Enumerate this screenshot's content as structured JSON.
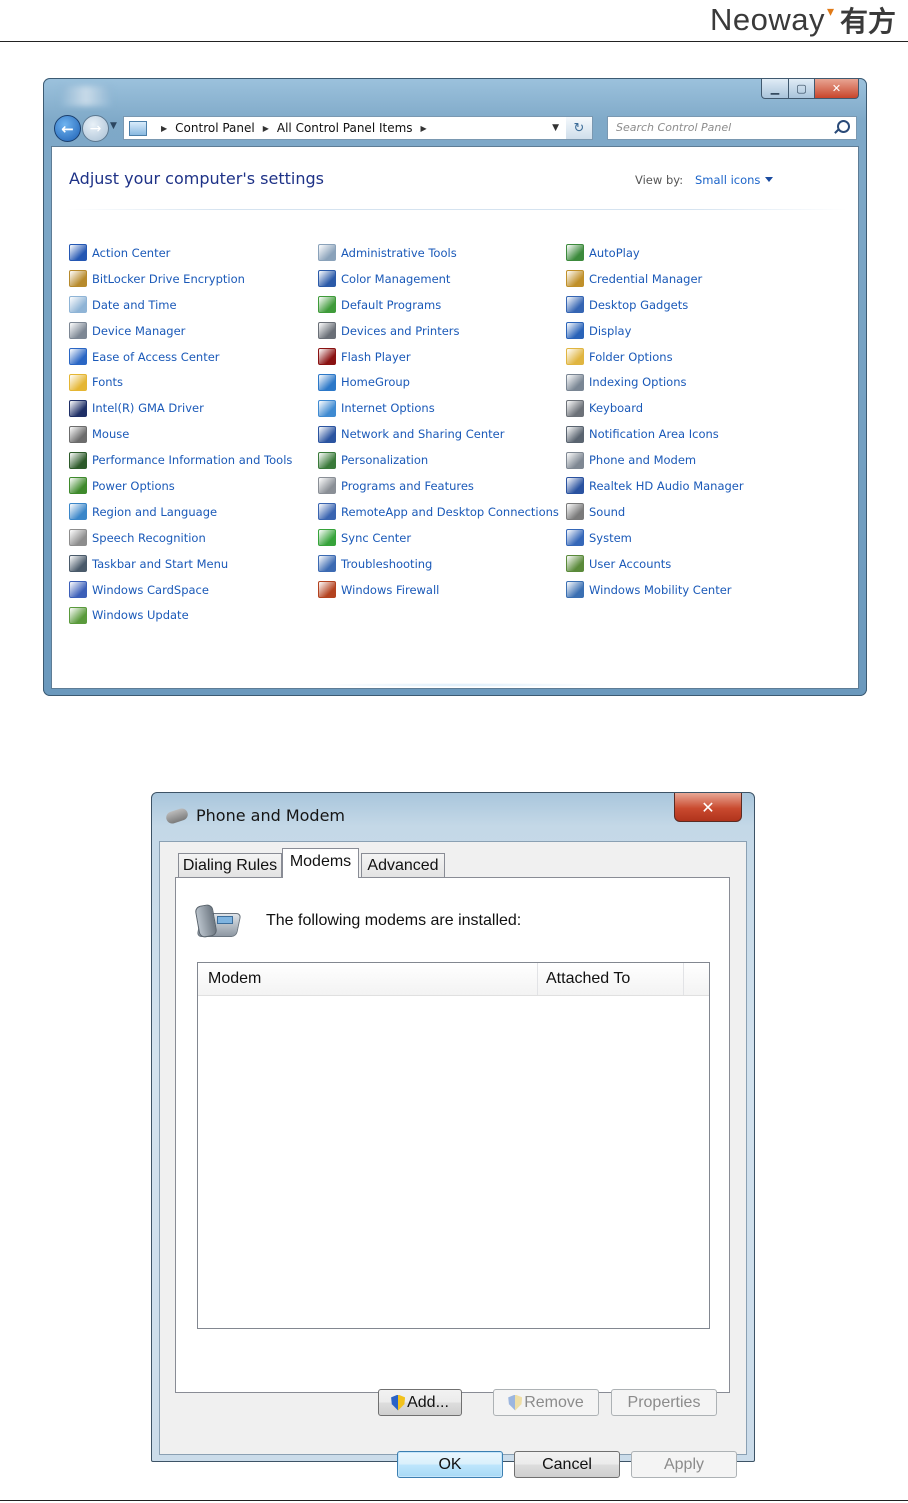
{
  "header": {
    "logo_text": "Neoway",
    "logo_cn": "有方"
  },
  "control_panel": {
    "breadcrumb": [
      "Control Panel",
      "All Control Panel Items"
    ],
    "search_placeholder": "Search Control Panel",
    "heading": "Adjust your computer's settings",
    "view_by_label": "View by:",
    "view_by_value": "Small icons",
    "columns": [
      [
        {
          "label": "Action Center",
          "icon": "flag-icon",
          "color": "#2457b3"
        },
        {
          "label": "BitLocker Drive Encryption",
          "icon": "bitlocker-icon",
          "color": "#b78a2c"
        },
        {
          "label": "Date and Time",
          "icon": "clock-icon",
          "color": "#8fb4d6"
        },
        {
          "label": "Device Manager",
          "icon": "device-manager-icon",
          "color": "#7d8794"
        },
        {
          "label": "Ease of Access Center",
          "icon": "ease-of-access-icon",
          "color": "#2a66c4"
        },
        {
          "label": "Fonts",
          "icon": "fonts-icon",
          "color": "#e5b633"
        },
        {
          "label": "Intel(R) GMA Driver",
          "icon": "intel-gma-icon",
          "color": "#1f2f66"
        },
        {
          "label": "Mouse",
          "icon": "mouse-icon",
          "color": "#6c6c6c"
        },
        {
          "label": "Performance Information and Tools",
          "icon": "performance-icon",
          "color": "#2d5a2a"
        },
        {
          "label": "Power Options",
          "icon": "power-icon",
          "color": "#3f8a2c"
        },
        {
          "label": "Region and Language",
          "icon": "globe-icon",
          "color": "#3a86c9"
        },
        {
          "label": "Speech Recognition",
          "icon": "microphone-icon",
          "color": "#8d8d8d"
        },
        {
          "label": "Taskbar and Start Menu",
          "icon": "taskbar-icon",
          "color": "#4a5a6a"
        },
        {
          "label": "Windows CardSpace",
          "icon": "cardspace-icon",
          "color": "#3c5fb8"
        },
        {
          "label": "Windows Update",
          "icon": "windows-update-icon",
          "color": "#5a9a3c"
        }
      ],
      [
        {
          "label": "Administrative Tools",
          "icon": "admin-tools-icon",
          "color": "#8aa2ba"
        },
        {
          "label": "Color Management",
          "icon": "color-management-icon",
          "color": "#2b5aa8"
        },
        {
          "label": "Default Programs",
          "icon": "default-programs-icon",
          "color": "#3f9b3a"
        },
        {
          "label": "Devices and Printers",
          "icon": "printer-icon",
          "color": "#6a6f77"
        },
        {
          "label": "Flash Player",
          "icon": "flash-icon",
          "color": "#8a1212"
        },
        {
          "label": "HomeGroup",
          "icon": "homegroup-icon",
          "color": "#2c78c8"
        },
        {
          "label": "Internet Options",
          "icon": "internet-options-icon",
          "color": "#3f8ad1"
        },
        {
          "label": "Network and Sharing Center",
          "icon": "network-icon",
          "color": "#2b54a0"
        },
        {
          "label": "Personalization",
          "icon": "personalization-icon",
          "color": "#3a7a3a"
        },
        {
          "label": "Programs and Features",
          "icon": "programs-icon",
          "color": "#8a8f96"
        },
        {
          "label": "RemoteApp and Desktop Connections",
          "icon": "remoteapp-icon",
          "color": "#3a64b0"
        },
        {
          "label": "Sync Center",
          "icon": "sync-icon",
          "color": "#36a33a"
        },
        {
          "label": "Troubleshooting",
          "icon": "troubleshooting-icon",
          "color": "#3c6ab2"
        },
        {
          "label": "Windows Firewall",
          "icon": "firewall-icon",
          "color": "#b3421f"
        }
      ],
      [
        {
          "label": "AutoPlay",
          "icon": "autoplay-icon",
          "color": "#3c8a3c"
        },
        {
          "label": "Credential Manager",
          "icon": "credential-icon",
          "color": "#c0902a"
        },
        {
          "label": "Desktop Gadgets",
          "icon": "gadgets-icon",
          "color": "#3565b3"
        },
        {
          "label": "Display",
          "icon": "display-icon",
          "color": "#2a63b8"
        },
        {
          "label": "Folder Options",
          "icon": "folder-options-icon",
          "color": "#e0b540"
        },
        {
          "label": "Indexing Options",
          "icon": "indexing-icon",
          "color": "#7a8694"
        },
        {
          "label": "Keyboard",
          "icon": "keyboard-icon",
          "color": "#6c7178"
        },
        {
          "label": "Notification Area Icons",
          "icon": "notification-icon",
          "color": "#5a6470"
        },
        {
          "label": "Phone and Modem",
          "icon": "phone-modem-icon",
          "color": "#7f8893"
        },
        {
          "label": "Realtek HD Audio Manager",
          "icon": "audio-manager-icon",
          "color": "#2a52a0"
        },
        {
          "label": "Sound",
          "icon": "speaker-icon",
          "color": "#7a7a7a"
        },
        {
          "label": "System",
          "icon": "system-icon",
          "color": "#3567b8"
        },
        {
          "label": "User Accounts",
          "icon": "user-accounts-icon",
          "color": "#5a8a3a"
        },
        {
          "label": "Windows Mobility Center",
          "icon": "mobility-center-icon",
          "color": "#3a6fb2"
        }
      ]
    ]
  },
  "phone_modem_dialog": {
    "title": "Phone and Modem",
    "close_glyph": "✕",
    "tabs": [
      "Dialing Rules",
      "Modems",
      "Advanced"
    ],
    "active_tab": "Modems",
    "intro": "The following modems are installed:",
    "list_columns": [
      "Modem",
      "Attached To"
    ],
    "buttons": {
      "add": "Add...",
      "remove": "Remove",
      "properties": "Properties",
      "ok": "OK",
      "cancel": "Cancel",
      "apply": "Apply"
    }
  }
}
